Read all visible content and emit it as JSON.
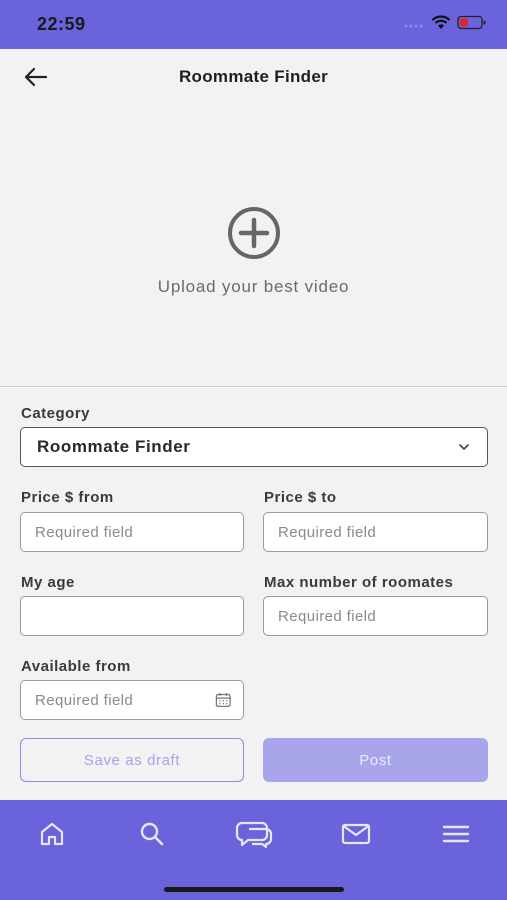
{
  "status_bar": {
    "time": "22:59"
  },
  "header": {
    "title": "Roommate Finder"
  },
  "upload": {
    "label": "Upload your best video"
  },
  "form": {
    "category": {
      "label": "Category",
      "value": "Roommate Finder"
    },
    "price_from": {
      "label": "Price $ from",
      "placeholder": "Required field"
    },
    "price_to": {
      "label": "Price $ to",
      "placeholder": "Required field"
    },
    "my_age": {
      "label": "My age",
      "placeholder": ""
    },
    "max_roommates": {
      "label": "Max number of roomates",
      "placeholder": "Required field"
    },
    "available_from": {
      "label": "Available from",
      "placeholder": "Required field"
    }
  },
  "actions": {
    "save_draft": "Save as draft",
    "post": "Post"
  },
  "bottom_nav": {
    "items": [
      {
        "icon": "home-icon"
      },
      {
        "icon": "search-icon"
      },
      {
        "icon": "chat-bubbles-icon"
      },
      {
        "icon": "mail-icon"
      },
      {
        "icon": "menu-icon"
      }
    ]
  },
  "colors": {
    "accent": "#6a63dc",
    "post_disabled": "#a9a5ea",
    "draft_text": "#a7a2ea"
  }
}
